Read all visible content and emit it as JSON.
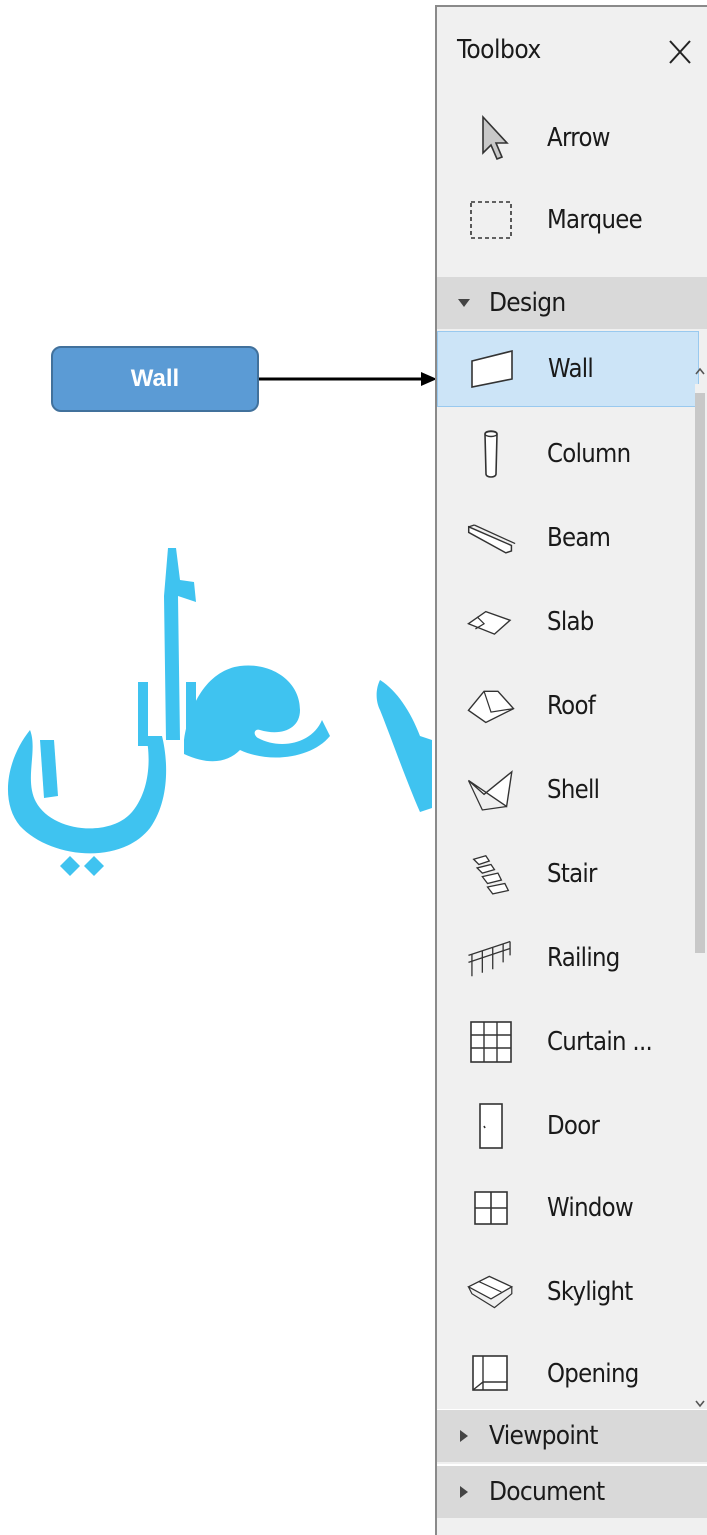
{
  "callout": {
    "label": "Wall"
  },
  "toolbox": {
    "title": "Toolbox",
    "top_tools": [
      {
        "label": "Arrow",
        "icon": "arrow-icon"
      },
      {
        "label": "Marquee",
        "icon": "marquee-icon"
      }
    ],
    "design_section": {
      "label": "Design",
      "expanded": true,
      "selected": "Wall",
      "tools": [
        {
          "label": "Wall",
          "icon": "wall-icon"
        },
        {
          "label": "Column",
          "icon": "column-icon"
        },
        {
          "label": "Beam",
          "icon": "beam-icon"
        },
        {
          "label": "Slab",
          "icon": "slab-icon"
        },
        {
          "label": "Roof",
          "icon": "roof-icon"
        },
        {
          "label": "Shell",
          "icon": "shell-icon"
        },
        {
          "label": "Stair",
          "icon": "stair-icon"
        },
        {
          "label": "Railing",
          "icon": "railing-icon"
        },
        {
          "label": "Curtain ...",
          "icon": "curtain-wall-icon"
        },
        {
          "label": "Door",
          "icon": "door-icon"
        },
        {
          "label": "Window",
          "icon": "window-icon"
        },
        {
          "label": "Skylight",
          "icon": "skylight-icon"
        },
        {
          "label": "Opening",
          "icon": "opening-icon"
        }
      ]
    },
    "collapsed_sections": [
      {
        "label": "Viewpoint"
      },
      {
        "label": "Document"
      }
    ]
  },
  "colors": {
    "callout_fill": "#5b9bd5",
    "callout_border": "#41719c",
    "selection": "#cce4f7",
    "watermark": "#3fc3f0"
  },
  "watermark": {
    "text": "علي",
    "is_logo": true
  }
}
